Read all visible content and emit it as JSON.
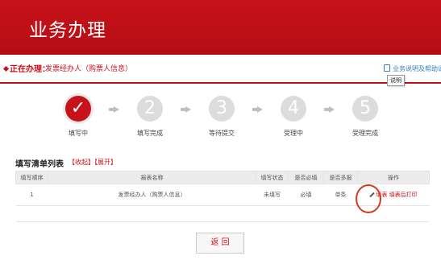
{
  "header": {
    "title": "业务办理"
  },
  "working": {
    "label": "正在办理：",
    "value": "发票经办人（购票人信息）"
  },
  "guide": {
    "link": "业务说明及帮助说明",
    "tooltip": "说明"
  },
  "steps": [
    {
      "number": "✓",
      "label": "填写中",
      "active": true
    },
    {
      "number": "2",
      "label": "填写完成",
      "active": false
    },
    {
      "number": "3",
      "label": "等待提交",
      "active": false
    },
    {
      "number": "4",
      "label": "受理中",
      "active": false
    },
    {
      "number": "5",
      "label": "受理完成",
      "active": false
    }
  ],
  "list": {
    "title": "填写清单列表",
    "collapse": "【收起】",
    "expand": "【展开】",
    "columns": [
      "填写顺序",
      "报表名称",
      "填写状态",
      "是否必填",
      "是否多报",
      "操作"
    ],
    "rows": [
      {
        "order": "1",
        "name": "发票经办人（购票人信息）",
        "status": "未填写",
        "required": "必填",
        "multiple": "单条",
        "edit": "填表",
        "print": "填表后打印"
      }
    ]
  },
  "return_button": "返 回",
  "colors": {
    "brand": "#c8121a",
    "step_inactive": "#dcdcdc",
    "link": "#3a7fc2"
  }
}
